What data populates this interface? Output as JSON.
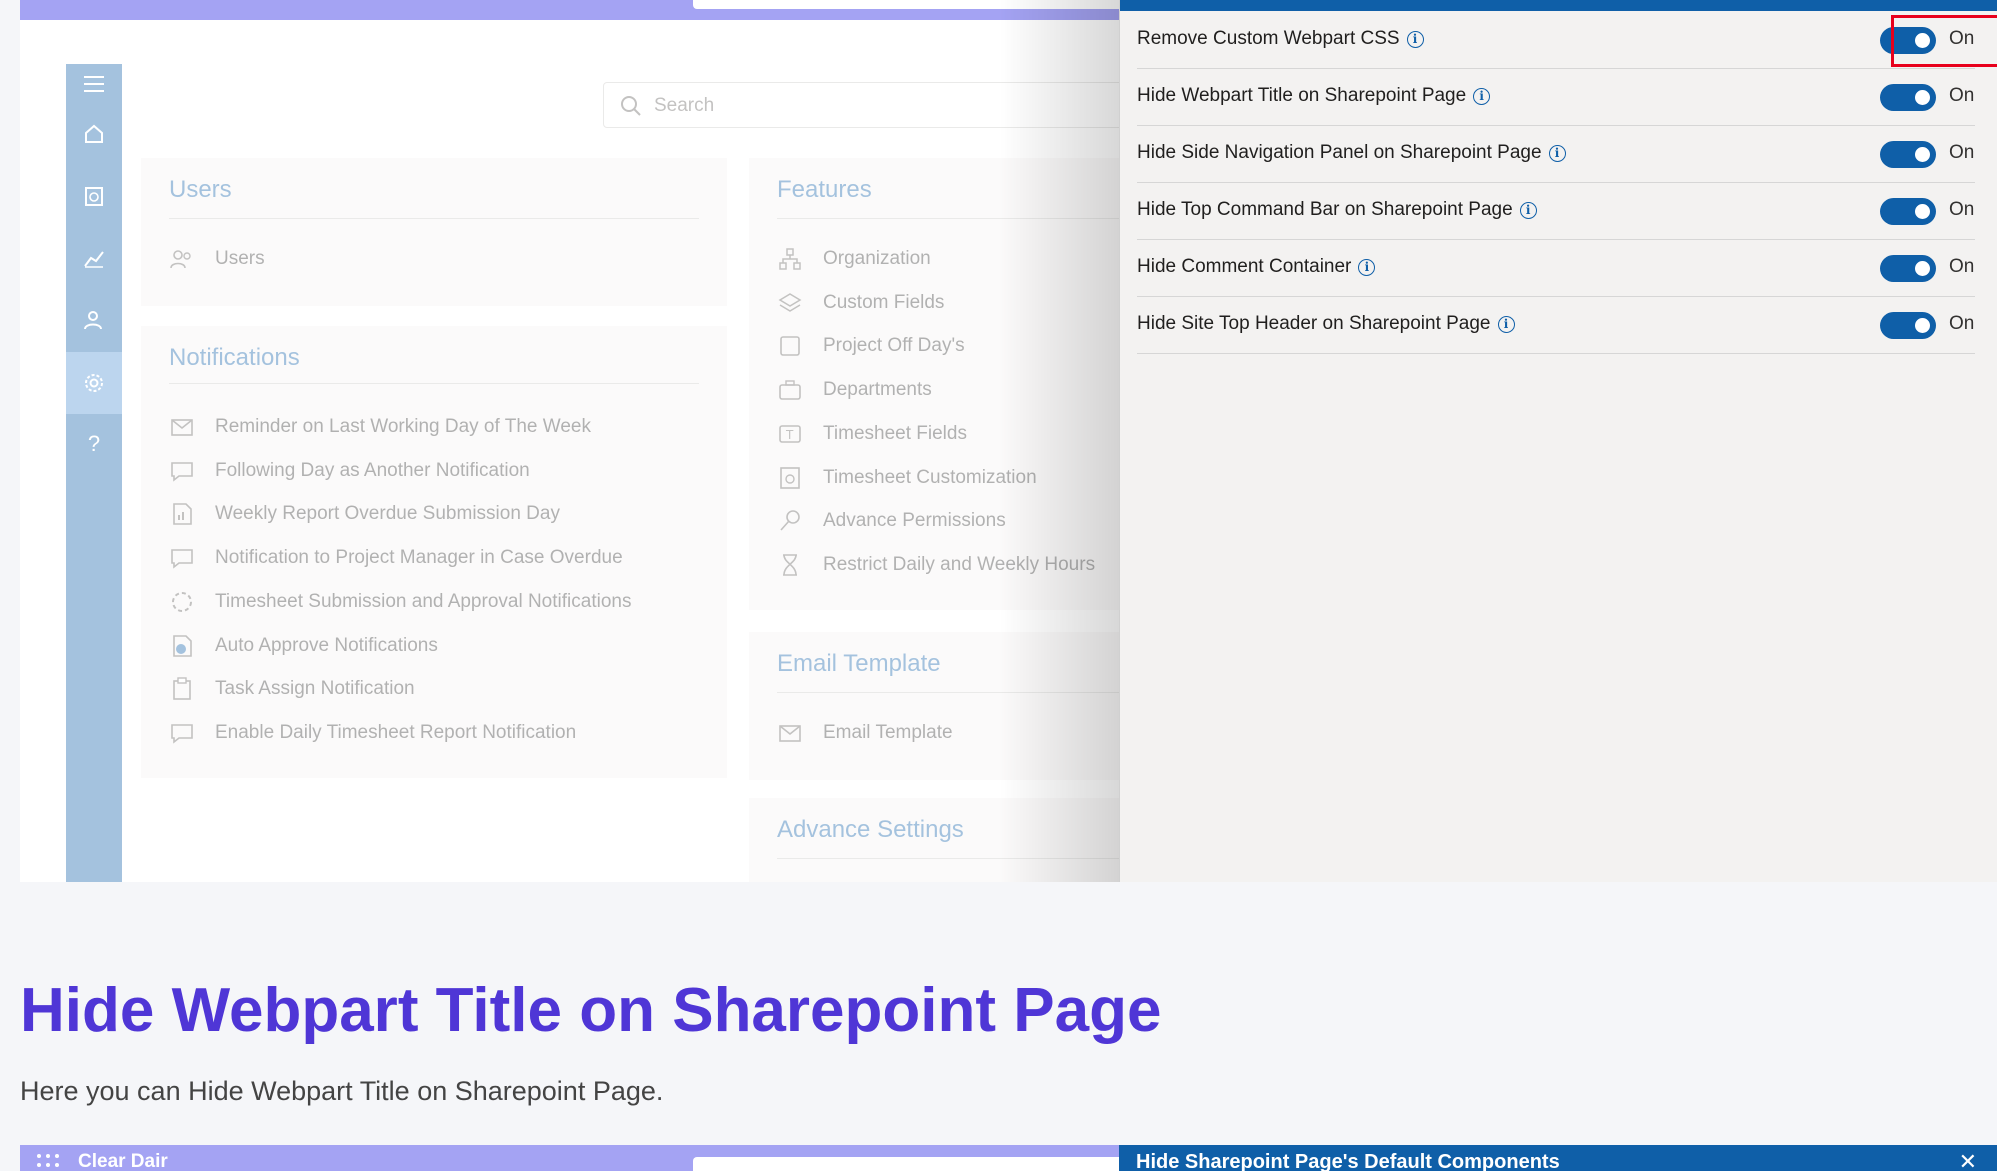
{
  "search": {
    "placeholder": "Search"
  },
  "users_card": {
    "title": "Users",
    "items": [
      {
        "label": "Users",
        "icon": "users-icon"
      }
    ]
  },
  "notifications_card": {
    "title": "Notifications",
    "items": [
      {
        "label": "Reminder on Last Working Day of The Week",
        "icon": "mail-icon"
      },
      {
        "label": "Following Day as Another Notification",
        "icon": "comment-icon"
      },
      {
        "label": "Weekly Report Overdue Submission Day",
        "icon": "report-icon"
      },
      {
        "label": "Notification to Project Manager in Case Overdue",
        "icon": "comment-icon"
      },
      {
        "label": "Timesheet Submission and Approval Notifications",
        "icon": "progress-icon"
      },
      {
        "label": "Auto Approve Notifications",
        "icon": "approve-icon"
      },
      {
        "label": "Task Assign Notification",
        "icon": "clipboard-icon"
      },
      {
        "label": "Enable Daily Timesheet Report Notification",
        "icon": "comment-icon"
      }
    ]
  },
  "features_card": {
    "title": "Features",
    "items": [
      {
        "label": "Organization",
        "icon": "org-icon"
      },
      {
        "label": "Custom Fields",
        "icon": "layers-icon"
      },
      {
        "label": "Project Off Day's",
        "icon": "square-icon"
      },
      {
        "label": "Departments",
        "icon": "briefcase-icon"
      },
      {
        "label": "Timesheet Fields",
        "icon": "text-field-icon"
      },
      {
        "label": "Timesheet Customization",
        "icon": "timesheet-icon"
      },
      {
        "label": "Advance Permissions",
        "icon": "key-icon"
      },
      {
        "label": "Restrict Daily and Weekly Hours",
        "icon": "hourglass-icon"
      }
    ]
  },
  "email_card": {
    "title": "Email Template",
    "items": [
      {
        "label": "Email Template",
        "icon": "mail-icon"
      }
    ]
  },
  "advance_card": {
    "title": "Advance Settings"
  },
  "panel": {
    "settings": [
      {
        "label": "Remove Custom Webpart CSS",
        "state": "On",
        "enabled": true
      },
      {
        "label": "Hide Webpart Title on Sharepoint Page",
        "state": "On",
        "enabled": true
      },
      {
        "label": "Hide Side Navigation Panel on Sharepoint Page",
        "state": "On",
        "enabled": true
      },
      {
        "label": "Hide Top Command Bar on Sharepoint Page",
        "state": "On",
        "enabled": true
      },
      {
        "label": "Hide Comment Container",
        "state": "On",
        "enabled": true
      },
      {
        "label": "Hide Site Top Header on Sharepoint Page",
        "state": "On",
        "enabled": true
      }
    ]
  },
  "article": {
    "heading": "Hide Webpart Title on Sharepoint Page",
    "description": "Here you can Hide Webpart Title on Sharepoint Page."
  },
  "shot2": {
    "app_brand": "Clear Dair",
    "panel_title": "Hide Sharepoint Page's Default Components",
    "close_icon": "close-icon"
  },
  "colors": {
    "accent": "#0f5fa8",
    "heading": "#4f36d6",
    "highlight": "#e8001c",
    "banner": "#a4a3f3"
  }
}
